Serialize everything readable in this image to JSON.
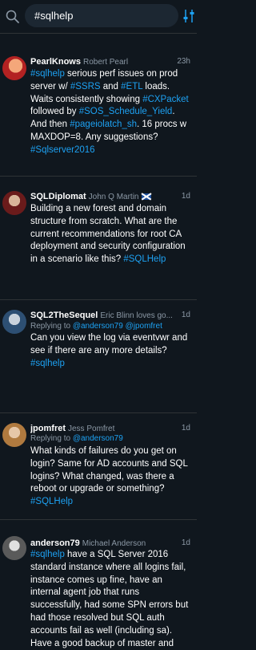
{
  "search": {
    "query": "#sqlhelp"
  },
  "tweets": [
    {
      "name": "PearlKnows",
      "handle": "Robert Pearl",
      "time": "23h",
      "reply_prefix": "",
      "reply_to": "",
      "reply_joiner": "",
      "reply_to2": "",
      "parts": [
        {
          "t": "#sqlhelp",
          "link": true
        },
        {
          "t": " serious perf issues on prod server w/ ",
          "link": false
        },
        {
          "t": "#SSRS",
          "link": true
        },
        {
          "t": " and ",
          "link": false
        },
        {
          "t": "#ETL",
          "link": true
        },
        {
          "t": " loads. Waits consistently showing ",
          "link": false
        },
        {
          "t": "#CXPacket",
          "link": true
        },
        {
          "t": " followed by ",
          "link": false
        },
        {
          "t": "#SOS_Schedule_Yield",
          "link": true
        },
        {
          "t": ". And then ",
          "link": false
        },
        {
          "t": "#pageiolatch_sh",
          "link": true
        },
        {
          "t": ". 16 procs w MAXDOP=8. Any suggestions? ",
          "link": false
        },
        {
          "t": "#Sqlserver2016",
          "link": true
        }
      ]
    },
    {
      "name": "SQLDiplomat",
      "handle": "John Q Martin",
      "time": "1d",
      "reply_prefix": "",
      "reply_to": "",
      "reply_joiner": "",
      "reply_to2": "",
      "parts": [
        {
          "t": "Building a new forest and domain structure from scratch. What are the current recommendations for root CA deployment and security configuration in a scenario like this? ",
          "link": false
        },
        {
          "t": "#SQLHelp",
          "link": true
        }
      ]
    },
    {
      "name": "SQL2TheSequel",
      "handle": "Eric Blinn loves go...",
      "time": "1d",
      "reply_prefix": "Replying to ",
      "reply_to": "@anderson79",
      "reply_joiner": " ",
      "reply_to2": "@jpomfret",
      "parts": [
        {
          "t": "Can you view the log via eventvwr and see if there are any more details? ",
          "link": false
        },
        {
          "t": "#sqlhelp",
          "link": true
        }
      ]
    },
    {
      "name": "jpomfret",
      "handle": "Jess Pomfret",
      "time": "1d",
      "reply_prefix": "Replying to ",
      "reply_to": "@anderson79",
      "reply_joiner": "",
      "reply_to2": "",
      "parts": [
        {
          "t": "What kinds of failures do you get on login? Same for AD accounts and SQL logins? What changed, was there a reboot or upgrade or something? ",
          "link": false
        },
        {
          "t": "#SQLHelp",
          "link": true
        }
      ]
    },
    {
      "name": "anderson79",
      "handle": "Michael Anderson",
      "time": "1d",
      "reply_prefix": "",
      "reply_to": "",
      "reply_joiner": "",
      "reply_to2": "",
      "parts": [
        {
          "t": "#sqlhelp",
          "link": true
        },
        {
          "t": " have a SQL Server 2016 standard instance where all logins fail, instance comes up fine, have an internal agent job that runs successfully, had some SPN errors but had those resolved but SQL auth accounts fail as well (including sa). Have a good backup of master and",
          "link": false
        }
      ]
    }
  ],
  "colors": {
    "background": "#10171e",
    "link": "#1da1f2",
    "muted": "#8b98a5",
    "divider": "#2f3336"
  }
}
